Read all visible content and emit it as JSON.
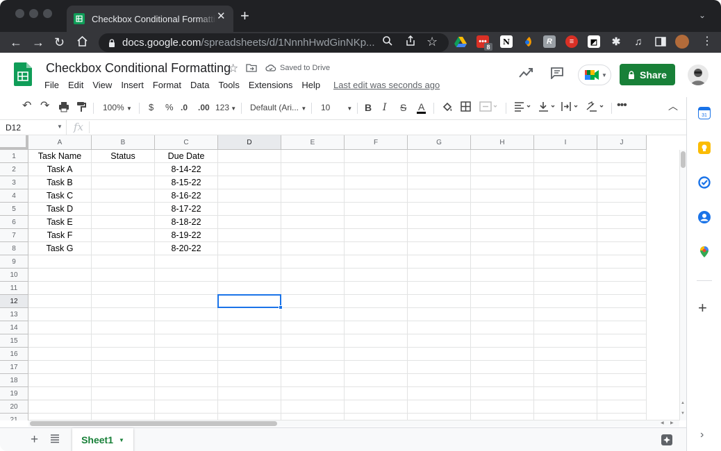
{
  "browser": {
    "tab_title": "Checkbox Conditional Formatting",
    "url_host": "docs.google.com",
    "url_path": "/spreadsheets/d/1NnnhHwdGinNKp...",
    "extension_badge": "8"
  },
  "app": {
    "doc_title": "Checkbox Conditional Formatting",
    "save_status": "Saved to Drive",
    "last_edit": "Last edit was seconds ago",
    "share_label": "Share",
    "menu": [
      "File",
      "Edit",
      "View",
      "Insert",
      "Format",
      "Data",
      "Tools",
      "Extensions",
      "Help"
    ]
  },
  "toolbar": {
    "zoom": "100%",
    "currency": "$",
    "percent": "%",
    "dec_decrease": ".0",
    "dec_increase": ".00",
    "more_formats": "123",
    "font": "Default (Ari...",
    "font_size": "10",
    "bold": "B",
    "italic": "I",
    "strike": "S",
    "text_color": "A"
  },
  "formula_bar": {
    "name_box": "D12",
    "fx": "fx",
    "value": ""
  },
  "sheet": {
    "columns": [
      "A",
      "B",
      "C",
      "D",
      "E",
      "F",
      "G",
      "H",
      "I",
      "J"
    ],
    "selected_column": "D",
    "selected_row": 12,
    "rows": [
      [
        "Task Name",
        "Status",
        "Due Date"
      ],
      [
        "Task A",
        "",
        "8-14-22"
      ],
      [
        "Task B",
        "",
        "8-15-22"
      ],
      [
        "Task C",
        "",
        "8-16-22"
      ],
      [
        "Task D",
        "",
        "8-17-22"
      ],
      [
        "Task E",
        "",
        "8-18-22"
      ],
      [
        "Task F",
        "",
        "8-19-22"
      ],
      [
        "Task G",
        "",
        "8-20-22"
      ]
    ],
    "row_count_visible": 21,
    "active_tab": "Sheet1"
  },
  "colors": {
    "accent": "#1a73e8",
    "brand_green": "#188038"
  }
}
